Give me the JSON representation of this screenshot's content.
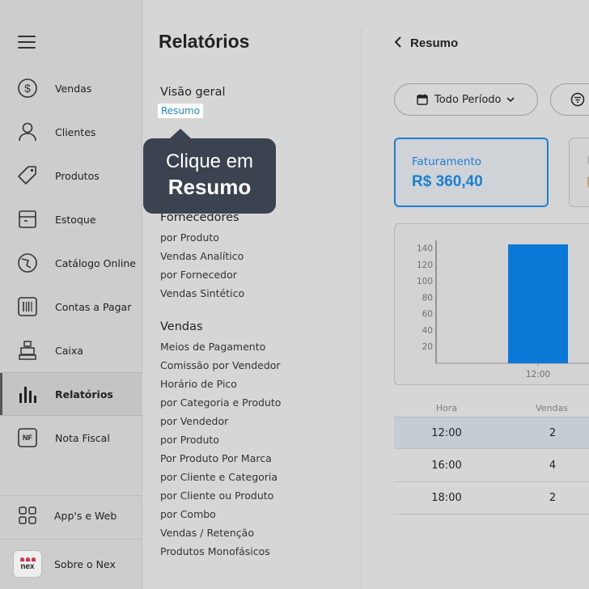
{
  "sidebar": {
    "items": [
      {
        "label": "Vendas",
        "icon": "dollar-icon"
      },
      {
        "label": "Clientes",
        "icon": "user-icon"
      },
      {
        "label": "Produtos",
        "icon": "tag-icon"
      },
      {
        "label": "Estoque",
        "icon": "box-icon"
      },
      {
        "label": "Catálogo Online",
        "icon": "catalog-icon"
      },
      {
        "label": "Contas a Pagar",
        "icon": "barcode-icon"
      },
      {
        "label": "Caixa",
        "icon": "cash-register-icon"
      },
      {
        "label": "Relatórios",
        "icon": "bar-chart-icon",
        "active": true
      },
      {
        "label": "Nota Fiscal",
        "icon": "nf-icon",
        "badge": "NF"
      }
    ],
    "apps_label": "App's e Web",
    "about_label": "Sobre o Nex",
    "logo_text": "nex"
  },
  "middle": {
    "title": "Relatórios",
    "overview": {
      "heading": "Visão geral",
      "links": [
        "Resumo"
      ]
    },
    "suppliers": {
      "heading": "Fornecedores",
      "links": [
        "por Produto",
        "Vendas Analítico",
        "por Fornecedor",
        "Vendas Sintético"
      ]
    },
    "sales": {
      "heading": "Vendas",
      "links": [
        "Meios de Pagamento",
        "Comissão por Vendedor",
        "Horário de Pico",
        "por Categoria e Produto",
        "por Vendedor",
        "por Produto",
        "Por Produto Por Marca",
        "por Cliente e Categoria",
        "por Cliente ou Produto",
        "por Combo",
        "Vendas / Retenção",
        "Produtos Monofásicos"
      ]
    }
  },
  "tooltip": {
    "line1": "Clique em",
    "line2": "Resumo"
  },
  "right": {
    "back_label": "Resumo",
    "period_label": "Todo Período",
    "card": {
      "label": "Faturamento",
      "value": "R$ 360,40"
    },
    "table": {
      "headers": [
        "Hora",
        "Vendas"
      ],
      "rows": [
        {
          "hora": "12:00",
          "vendas": "2",
          "selected": true
        },
        {
          "hora": "16:00",
          "vendas": "4"
        },
        {
          "hora": "18:00",
          "vendas": "2"
        }
      ]
    }
  },
  "colors": {
    "accent": "#1a7fd0",
    "link_highlight": "#1a8bd6",
    "tooltip_bg": "#3b4350",
    "bar": "#0a78d6",
    "brand_red": "#d8334a"
  },
  "chart_data": {
    "type": "bar",
    "categories": [
      "12:00"
    ],
    "values": [
      145
    ],
    "yticks": [
      20,
      40,
      60,
      80,
      100,
      120,
      140
    ],
    "ylim": [
      0,
      150
    ],
    "title": "",
    "xlabel": "",
    "ylabel": "",
    "grid": false
  }
}
